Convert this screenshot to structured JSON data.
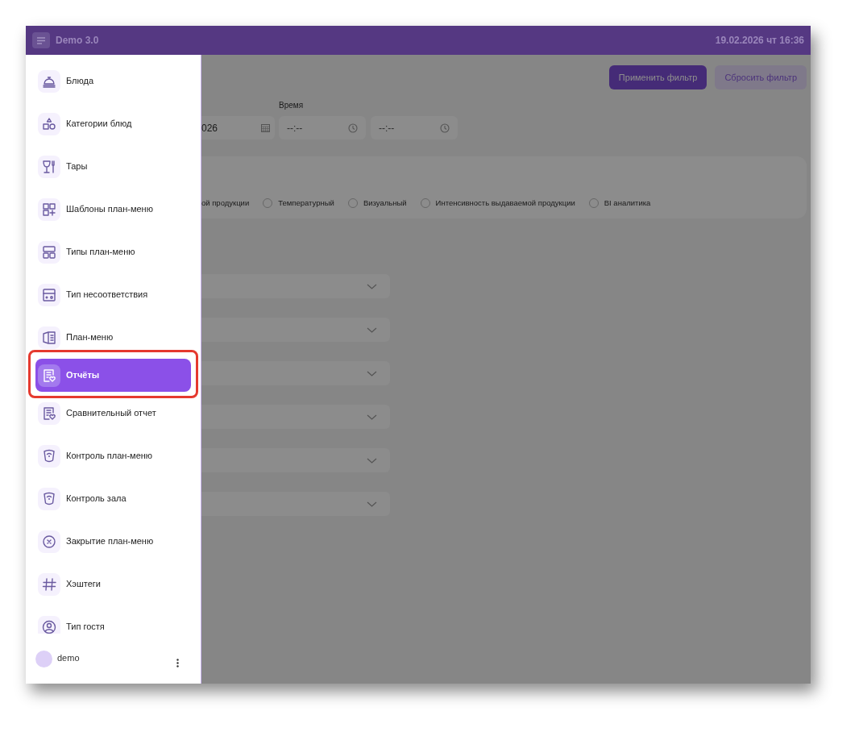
{
  "header": {
    "title": "Demo 3.0",
    "datetime": "19.02.2026 чт 16:36"
  },
  "sidebar": {
    "items": [
      {
        "label": "Блюда",
        "selected": false,
        "highlighted": false
      },
      {
        "label": "Категории блюд",
        "selected": false,
        "highlighted": false
      },
      {
        "label": "Тары",
        "selected": false,
        "highlighted": false
      },
      {
        "label": "Шаблоны план-меню",
        "selected": false,
        "highlighted": false
      },
      {
        "label": "Типы план-меню",
        "selected": false,
        "highlighted": false
      },
      {
        "label": "Тип несоответствия",
        "selected": false,
        "highlighted": false
      },
      {
        "label": "План-меню",
        "selected": false,
        "highlighted": false
      },
      {
        "label": "Отчёты",
        "selected": true,
        "highlighted": true
      },
      {
        "label": "Сравнительный отчет",
        "selected": false,
        "highlighted": false
      },
      {
        "label": "Контроль план-меню",
        "selected": false,
        "highlighted": false
      },
      {
        "label": "Контроль зала",
        "selected": false,
        "highlighted": false
      },
      {
        "label": "Закрытие план-меню",
        "selected": false,
        "highlighted": false
      },
      {
        "label": "Хэштеги",
        "selected": false,
        "highlighted": false
      },
      {
        "label": "Тип гостя",
        "selected": false,
        "highlighted": false
      }
    ],
    "user": "demo"
  },
  "filters": {
    "buttons": [
      {
        "label": "Применить фильтр",
        "kind": "primary"
      },
      {
        "label": "Сбросить фильтр",
        "kind": "secondary"
      }
    ],
    "date_value": "026",
    "cut_report_type_label": "ой продукции",
    "time_label": "Время",
    "time_from_placeholder": "--:--",
    "time_to_placeholder": "--:--",
    "report_types": [
      {
        "label": "Температурный",
        "selected": false
      },
      {
        "label": "Визуальный",
        "selected": false
      },
      {
        "label": "Интенсивность выдаваемой продукции",
        "selected": false
      },
      {
        "label": "BI аналитика",
        "selected": false
      }
    ],
    "dropdowns": [
      {
        "kind": "select"
      },
      {
        "kind": "select"
      },
      {
        "kind": "select"
      },
      {
        "kind": "select"
      },
      {
        "kind": "select"
      },
      {
        "kind": "select"
      }
    ]
  }
}
